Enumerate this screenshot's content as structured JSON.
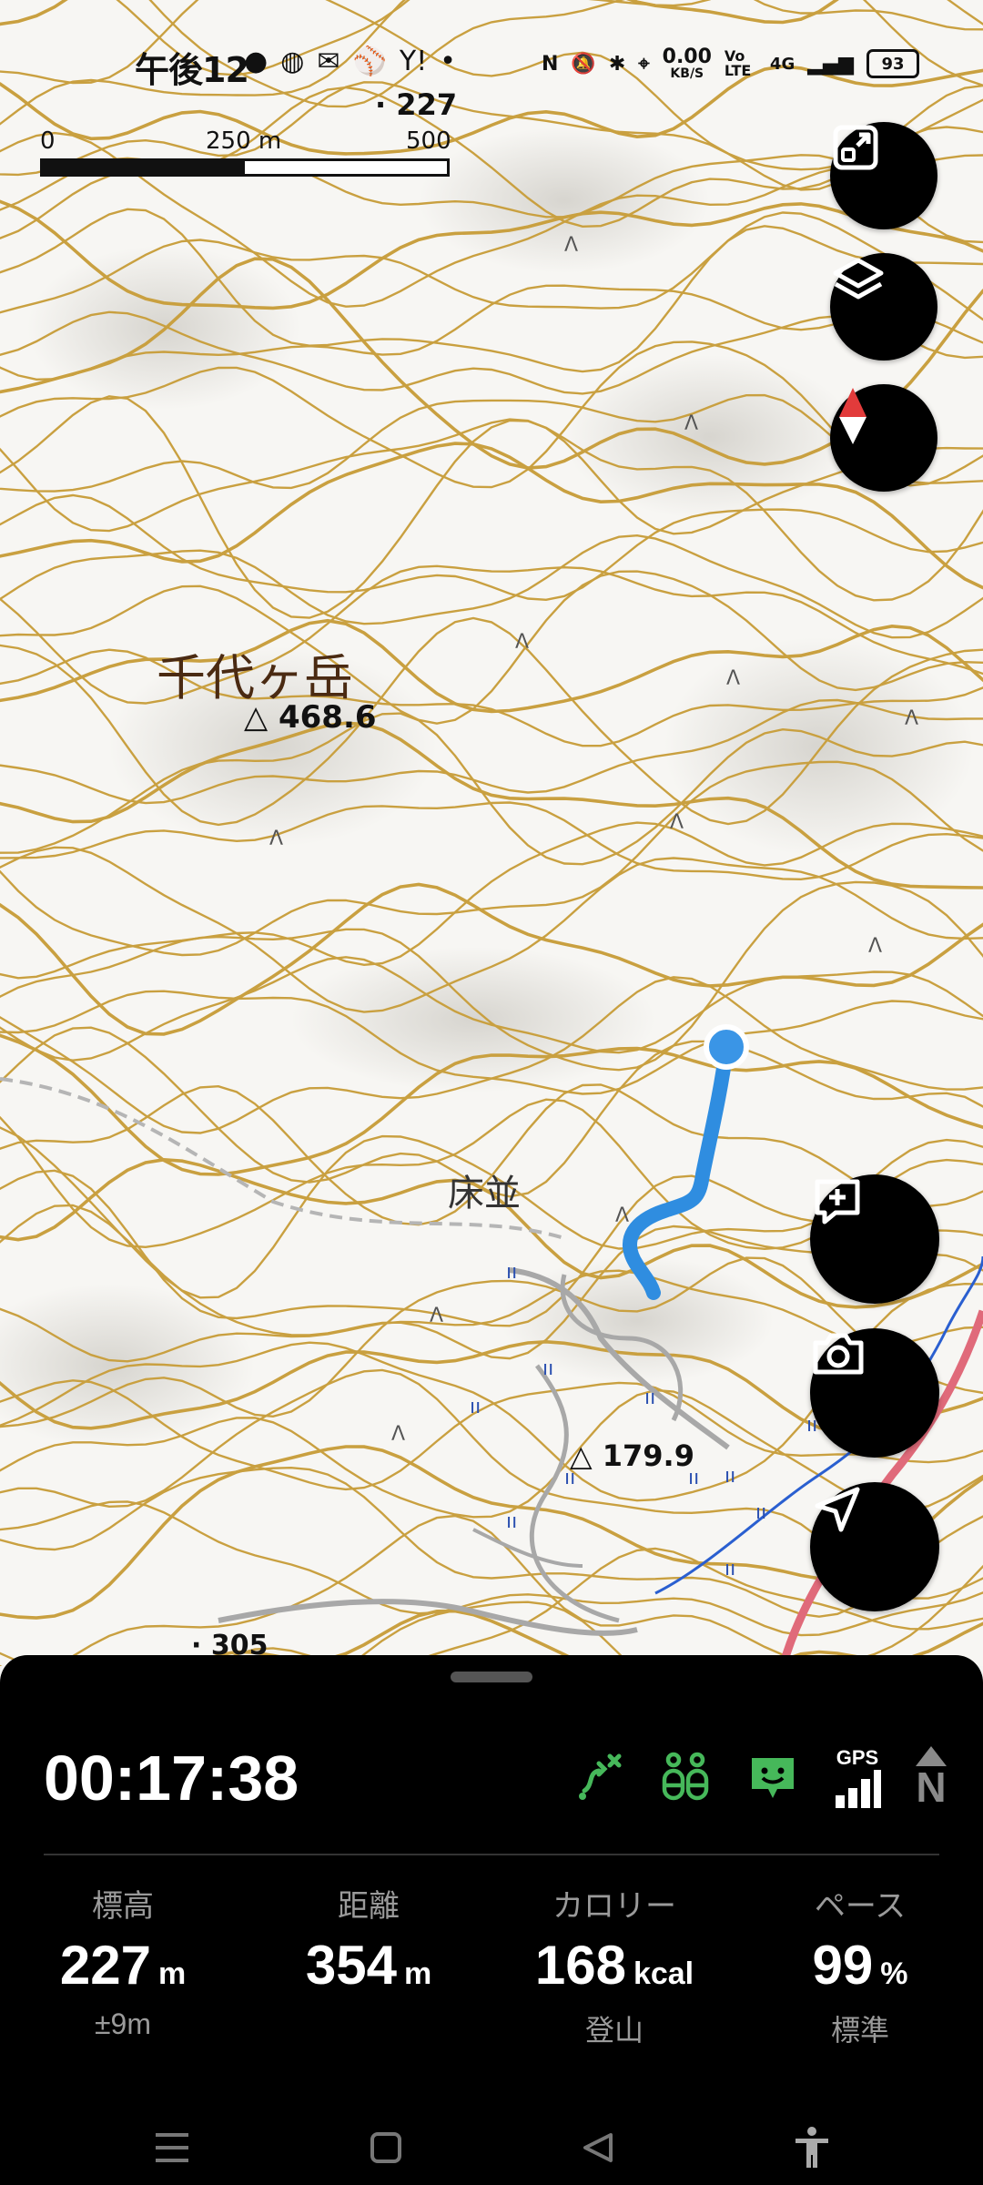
{
  "status_bar": {
    "time": "午後12",
    "elevation_readout": "227",
    "net_speed": "0.00",
    "net_speed_unit": "KB/S",
    "volte": "Vo LTE",
    "network": "4G",
    "battery": "93"
  },
  "scale_bar": {
    "label_0": "0",
    "label_mid": "250 m",
    "label_max": "500 m"
  },
  "map": {
    "peak_name": "千代ヶ岳",
    "peak_elevation": "468.6",
    "place_name": "床並",
    "point_elevation": "179.9",
    "edge_elevation": "305"
  },
  "panel": {
    "elapsed_time": "00:17:38",
    "gps_label": "GPS",
    "north_label": "N",
    "stats": [
      {
        "title": "標高",
        "value": "227",
        "unit": "m",
        "sub": "±9m"
      },
      {
        "title": "距離",
        "value": "354",
        "unit": "m",
        "sub": ""
      },
      {
        "title": "カロリー",
        "value": "168",
        "unit": "kcal",
        "sub": "登山"
      },
      {
        "title": "ペース",
        "value": "99",
        "unit": "%",
        "sub": "標準"
      }
    ]
  },
  "colors": {
    "contour": "#c9a040",
    "track": "#2f8de0",
    "road": "#9a9a9a",
    "river": "#2a5fd0",
    "railway": "#e06a7a",
    "panel_green": "#46b85a"
  },
  "icons": {
    "fab_1": "expand-icon",
    "fab_2": "layers-icon",
    "fab_3": "compass-icon",
    "fab_4": "add-note-icon",
    "fab_5": "camera-icon",
    "fab_6": "navigate-icon"
  }
}
